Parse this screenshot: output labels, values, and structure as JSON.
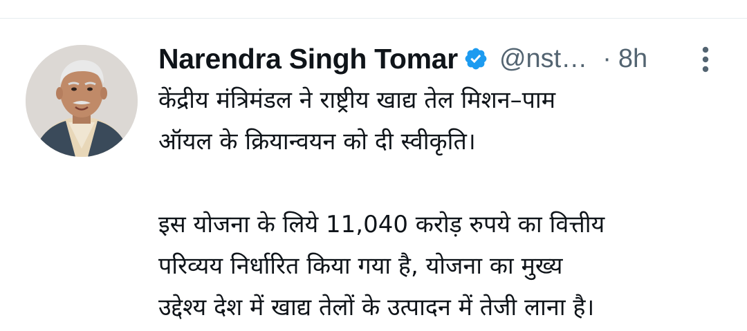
{
  "author": {
    "name": "Narendra Singh Tomar",
    "handle": "@nst…",
    "separator": "·",
    "timestamp": "8h",
    "verified": true
  },
  "tweet": {
    "lines_paragraph1": [
      "केंद्रीय मंत्रिमंडल ने राष्ट्रीय खाद्य तेल मिशन–पाम",
      "ऑयल के क्रियान्वयन को दी स्वीकृति।"
    ],
    "lines_paragraph2": [
      "इस योजना के लिये 11,040 करोड़ रुपये का वित्तीय",
      "परिव्यय निर्धारित किया गया है, योजना का मुख्य",
      "उद्देश्य देश में खाद्य तेलों के उत्पादन में तेजी लाना है।"
    ]
  },
  "icons": {
    "verified": "verified-badge-icon",
    "more": "more-vertical-icon"
  },
  "colors": {
    "text_primary": "#0f1419",
    "text_secondary": "#536471",
    "verified_blue": "#1d9bf0",
    "divider": "#e6ecf0"
  }
}
